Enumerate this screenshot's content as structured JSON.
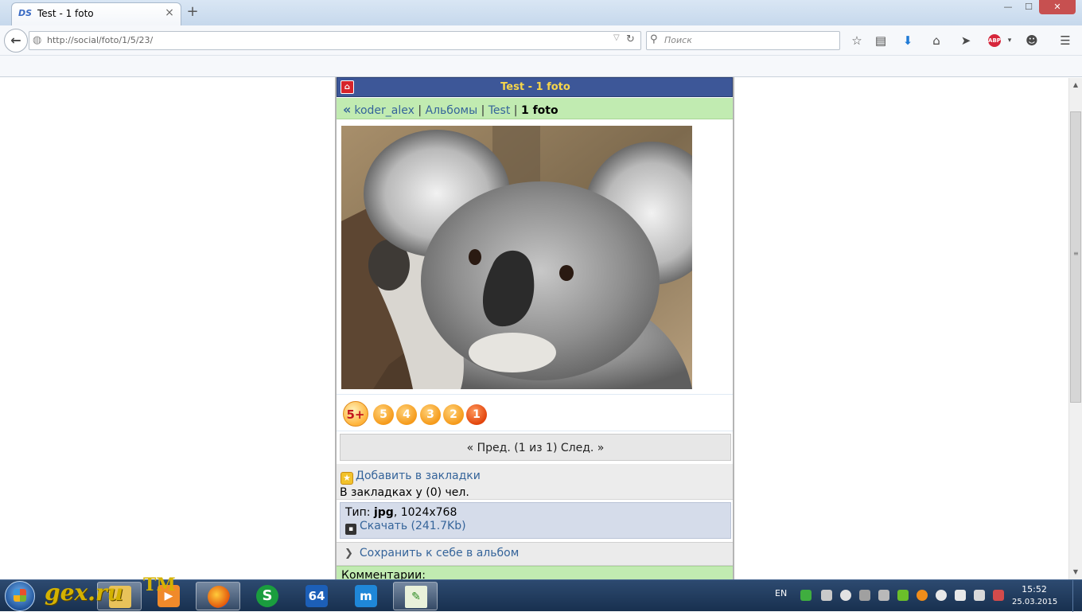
{
  "browser": {
    "tab_title": "Test - 1 foto",
    "tab_favicon_text": "DS",
    "tab_close": "×",
    "new_tab": "+",
    "window_min": "—",
    "window_max": "☐",
    "window_close": "✕",
    "url": "http://social/foto/1/5/23/",
    "search_placeholder": "Поиск",
    "toolbar_icons": [
      "bookmark-star-icon",
      "reading-list-icon",
      "download-icon",
      "home-icon",
      "send-icon",
      "adblock-icon",
      "chat-icon",
      "menu-icon"
    ],
    "abp_label": "ABP"
  },
  "page": {
    "header_title": "Test - 1 foto",
    "breadcrumb": {
      "arrow": "«",
      "user": "koder_alex",
      "albums": "Альбомы",
      "album": "Test",
      "current": "1 foto",
      "separator": "|"
    },
    "rating": {
      "top_label": "5+",
      "stars": [
        "5",
        "4",
        "3",
        "2",
        "1"
      ]
    },
    "pager": "« Пред. (1 из 1) След. »",
    "bookmarks": {
      "add_label": "Добавить в закладки",
      "count_text": "В закладках у (0) чел."
    },
    "file": {
      "type_label": "Тип:",
      "type_value": "jpg",
      "dimensions": ", 1024x768",
      "download_label": "Скачать (241.7Kb)"
    },
    "save_album_label": "Сохранить к себе в альбом",
    "comments_label": "Комментарии:"
  },
  "taskbar": {
    "watermark": "gex.ru",
    "watermark_tm": "TM",
    "lang": "EN",
    "time": "15:52",
    "date": "25.03.2015",
    "apps": [
      "explorer",
      "media-player",
      "firefox",
      "skype",
      "aida64",
      "maxthon",
      "notepad-plus"
    ]
  },
  "colors": {
    "header_bg": "#3d5798",
    "header_title": "#f7d64a",
    "breadcrumb_bg": "#c1ebb1",
    "link": "#35649a",
    "fileinfo_bg": "#d5dcea"
  }
}
